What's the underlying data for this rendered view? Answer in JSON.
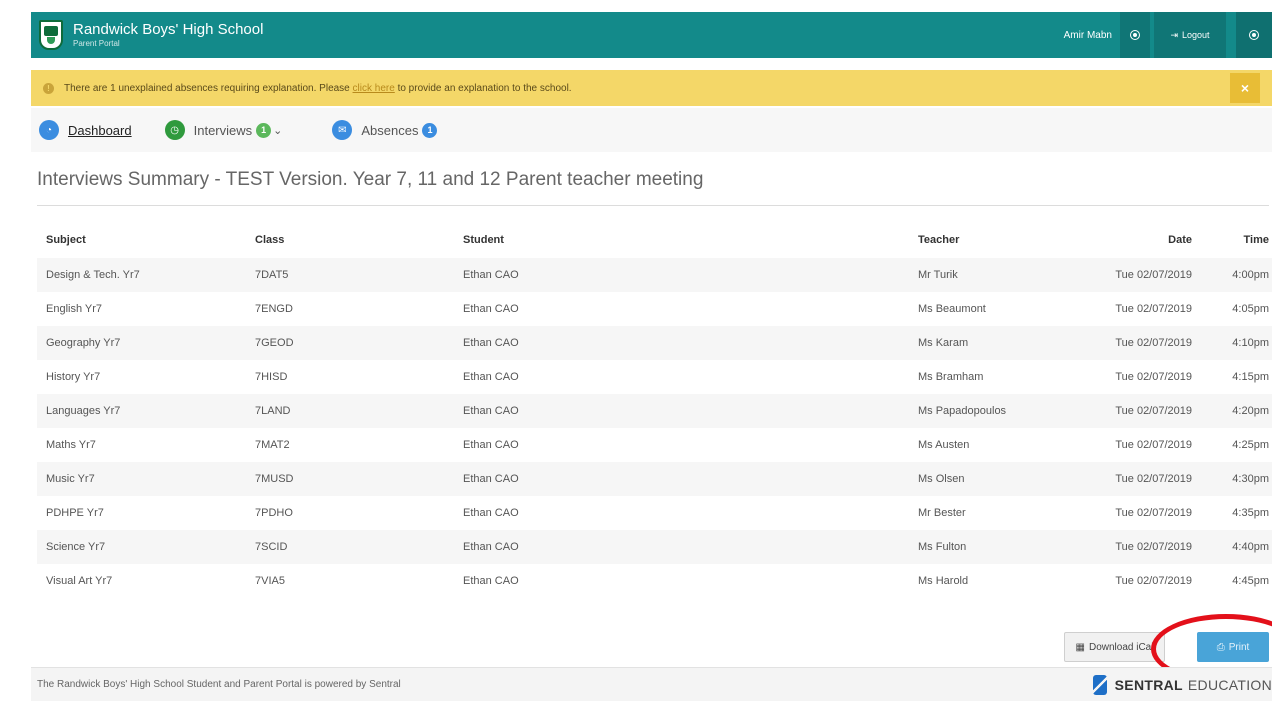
{
  "header": {
    "school_name": "Randwick Boys' High School",
    "portal_name": "Parent Portal",
    "user_name": "Amir Mabn",
    "logout_label": "Logout",
    "brand_color": "#138a8a"
  },
  "alert": {
    "text_before": "There are 1 unexplained absences requiring explanation. Please",
    "link_text": "click here",
    "text_after": "to provide an explanation to the school.",
    "close_icon": "×"
  },
  "nav": {
    "dashboard": "Dashboard",
    "interviews": "Interviews",
    "interviews_badge": "1",
    "absences": "Absences",
    "absences_badge": "1"
  },
  "page": {
    "title": "Interviews Summary - TEST Version. Year 7, 11 and 12 Parent teacher meeting"
  },
  "table": {
    "columns": [
      "Subject",
      "Class",
      "Student",
      "Teacher",
      "Date",
      "Time"
    ],
    "rows": [
      [
        "Design & Tech. Yr7",
        "7DAT5",
        "Ethan CAO",
        "Mr Turik",
        "Tue 02/07/2019",
        "4:00pm"
      ],
      [
        "English Yr7",
        "7ENGD",
        "Ethan CAO",
        "Ms Beaumont",
        "Tue 02/07/2019",
        "4:05pm"
      ],
      [
        "Geography Yr7",
        "7GEOD",
        "Ethan CAO",
        "Ms Karam",
        "Tue 02/07/2019",
        "4:10pm"
      ],
      [
        "History Yr7",
        "7HISD",
        "Ethan CAO",
        "Ms Bramham",
        "Tue 02/07/2019",
        "4:15pm"
      ],
      [
        "Languages Yr7",
        "7LAND",
        "Ethan CAO",
        "Ms Papadopoulos",
        "Tue 02/07/2019",
        "4:20pm"
      ],
      [
        "Maths Yr7",
        "7MAT2",
        "Ethan CAO",
        "Ms Austen",
        "Tue 02/07/2019",
        "4:25pm"
      ],
      [
        "Music Yr7",
        "7MUSD",
        "Ethan CAO",
        "Ms Olsen",
        "Tue 02/07/2019",
        "4:30pm"
      ],
      [
        "PDHPE Yr7",
        "7PDHO",
        "Ethan CAO",
        "Mr Bester",
        "Tue 02/07/2019",
        "4:35pm"
      ],
      [
        "Science Yr7",
        "7SCID",
        "Ethan CAO",
        "Ms Fulton",
        "Tue 02/07/2019",
        "4:40pm"
      ],
      [
        "Visual Art Yr7",
        "7VIA5",
        "Ethan CAO",
        "Ms Harold",
        "Tue 02/07/2019",
        "4:45pm"
      ]
    ]
  },
  "actions": {
    "download_ical": "Download iCal",
    "print": "Print"
  },
  "footer": {
    "text": "The Randwick Boys' High School Student and Parent Portal is powered by Sentral",
    "logo_bold": "SENTRAL",
    "logo_light": "EDUCATION"
  }
}
